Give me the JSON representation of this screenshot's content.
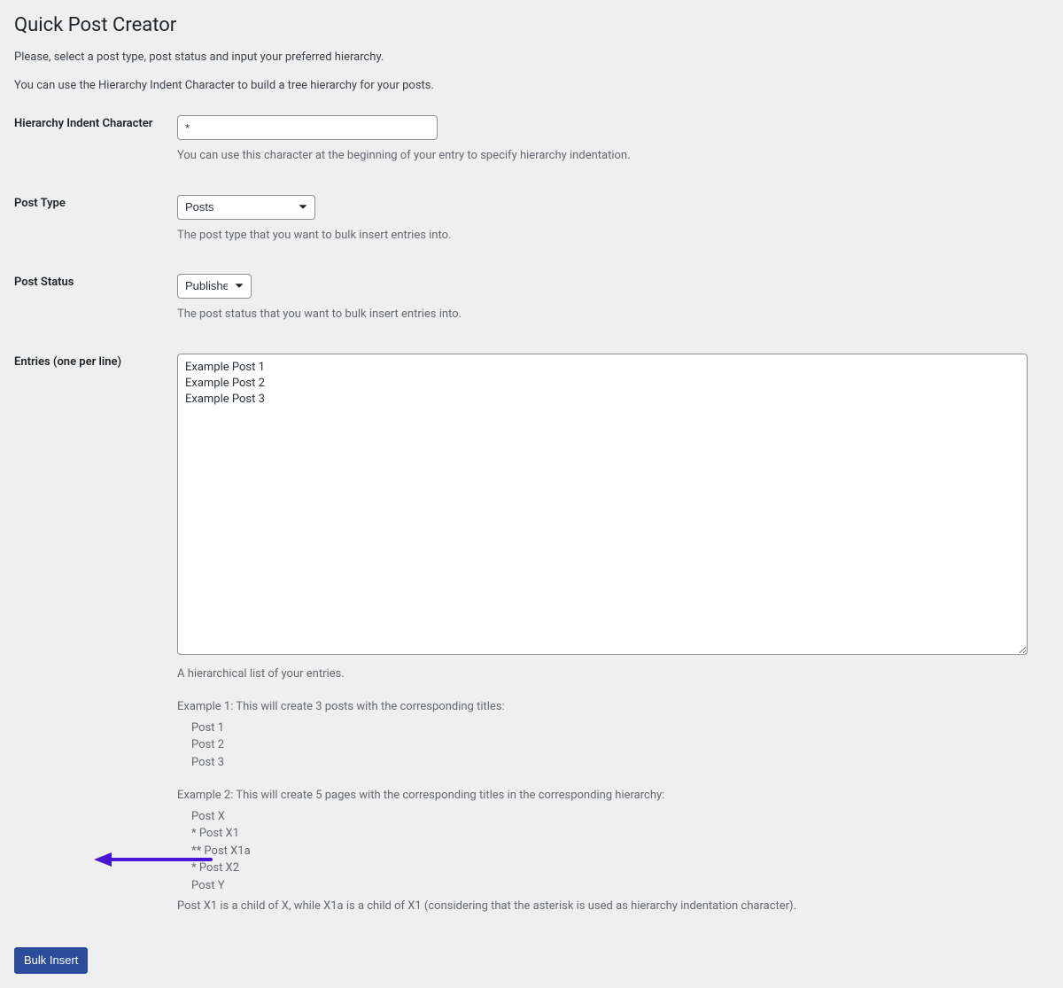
{
  "page": {
    "title": "Quick Post Creator",
    "intro1": "Please, select a post type, post status and input your preferred hierarchy.",
    "intro2": "You can use the Hierarchy Indent Character to build a tree hierarchy for your posts."
  },
  "fields": {
    "indent": {
      "label": "Hierarchy Indent Character",
      "value": "*",
      "desc": "You can use this character at the beginning of your entry to specify hierarchy indentation."
    },
    "posttype": {
      "label": "Post Type",
      "value": "Posts",
      "desc": "The post type that you want to bulk insert entries into."
    },
    "status": {
      "label": "Post Status",
      "value": "Published",
      "desc": "The post status that you want to bulk insert entries into."
    },
    "entries": {
      "label": "Entries (one per line)",
      "value": "Example Post 1\nExample Post 2\nExample Post 3",
      "desc": "A hierarchical list of your entries."
    }
  },
  "help": {
    "ex1_title": "Example 1: This will create 3 posts with the corresponding titles:",
    "ex1_l1": "Post 1",
    "ex1_l2": "Post 2",
    "ex1_l3": "Post 3",
    "ex2_title": "Example 2: This will create 5 pages with the corresponding titles in the corresponding hierarchy:",
    "ex2_l1": "Post X",
    "ex2_l2": "* Post X1",
    "ex2_l3": "** Post X1a",
    "ex2_l4": "* Post X2",
    "ex2_l5": "Post Y",
    "ex2_foot": "Post X1 is a child of X, while X1a is a child of X1 (considering that the asterisk is used as hierarchy indentation character)."
  },
  "actions": {
    "submit": "Bulk Insert"
  }
}
